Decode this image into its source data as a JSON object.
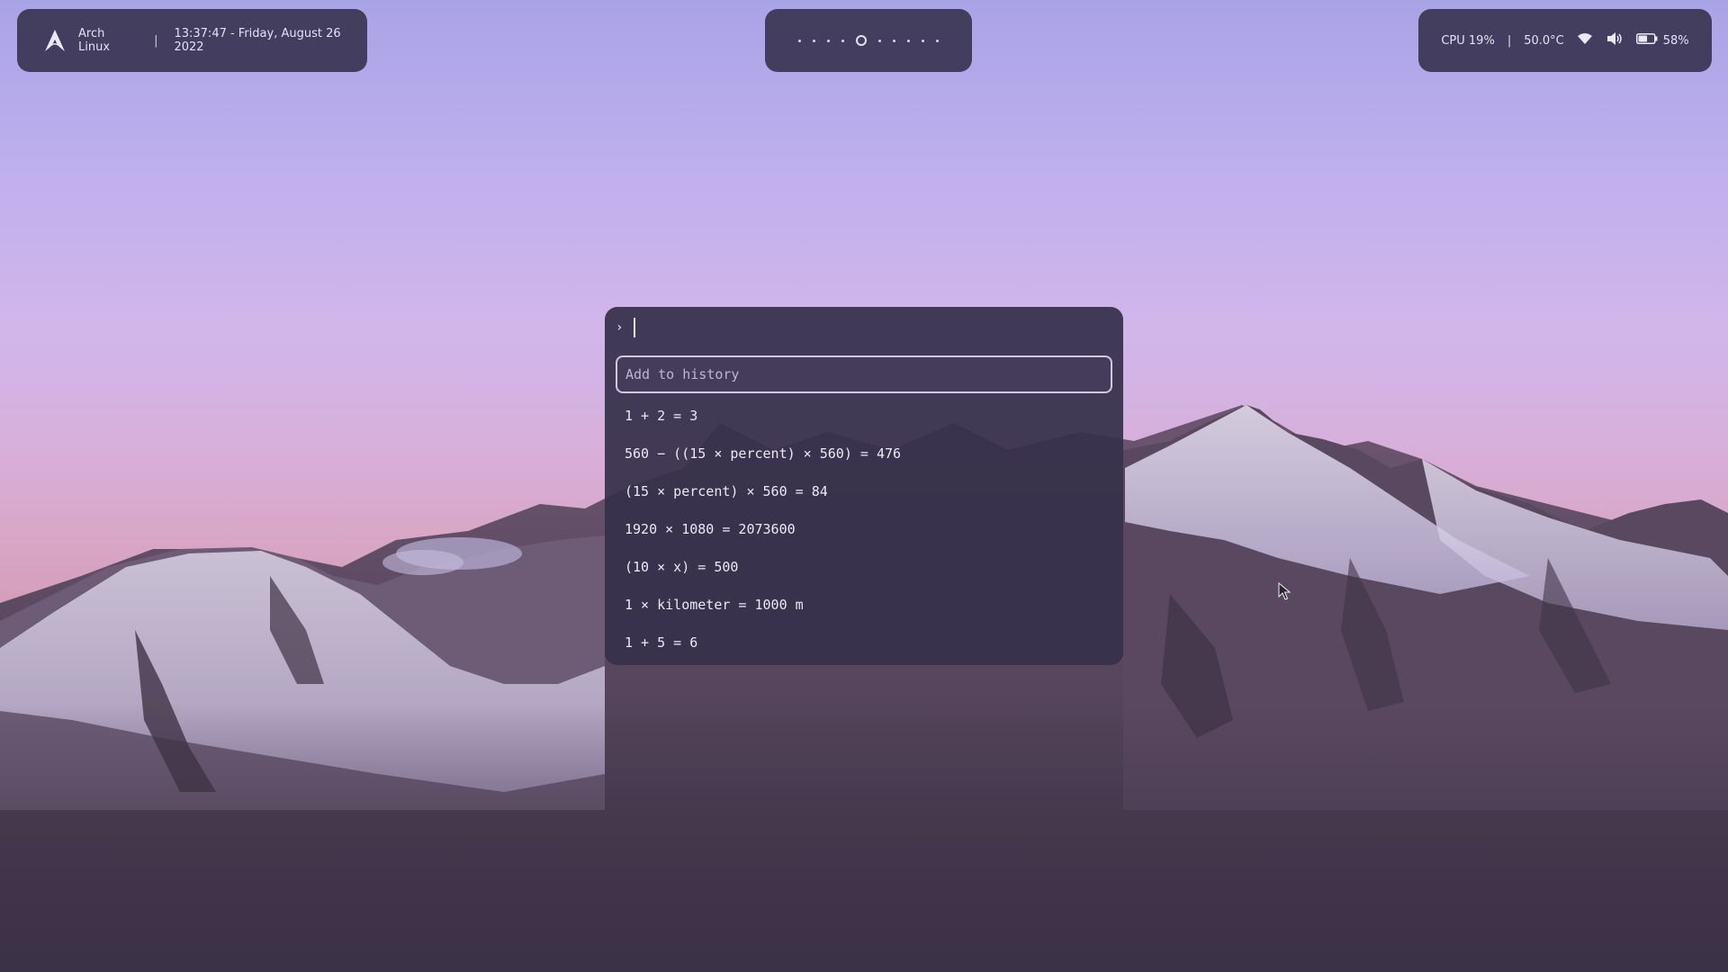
{
  "top_left_bar": {
    "distro_icon": "arch-linux-logo-icon",
    "distro_name": "Arch Linux",
    "separator": "|",
    "datetime": "13:37:47 - Friday, August 26 2022"
  },
  "workspaces": {
    "count": 10,
    "active_index": 4
  },
  "top_right_bar": {
    "cpu": "CPU 19%",
    "separator": "|",
    "temperature": "50.0°C",
    "wifi_icon": "wifi-icon",
    "volume_icon": "volume-icon",
    "battery_icon": "battery-icon",
    "battery": "58%",
    "battery_level": 0.58
  },
  "launcher": {
    "prompt_icon": "chevron-right-icon",
    "search_placeholder": "Add to history",
    "search_value": "",
    "history": [
      "1 + 2 = 3",
      "560 − ((15 × percent) × 560) = 476",
      "(15 × percent) × 560 = 84",
      "1920 × 1080 = 2073600",
      "(10 × x) = 500",
      "1 × kilometer = 1000 m",
      "1 + 5 = 6"
    ]
  },
  "colors": {
    "bar_bg": "#3a3452",
    "launcher_bg": "#36304a",
    "text": "#e8e3f2"
  }
}
